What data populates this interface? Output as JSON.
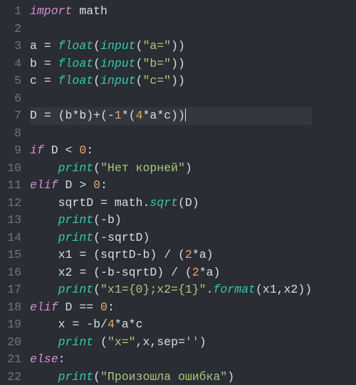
{
  "code_lines": [
    {
      "n": 1,
      "hl": false,
      "tokens": [
        [
          "kw",
          "import"
        ],
        [
          "ws",
          " "
        ],
        [
          "id",
          "math"
        ]
      ]
    },
    {
      "n": 2,
      "hl": false,
      "tokens": []
    },
    {
      "n": 3,
      "hl": false,
      "tokens": [
        [
          "id",
          "a"
        ],
        [
          "ws",
          " "
        ],
        [
          "op",
          "="
        ],
        [
          "ws",
          " "
        ],
        [
          "fn",
          "float"
        ],
        [
          "pn",
          "("
        ],
        [
          "fn",
          "input"
        ],
        [
          "pn",
          "("
        ],
        [
          "str",
          "\"a=\""
        ],
        [
          "pn",
          "))"
        ]
      ]
    },
    {
      "n": 4,
      "hl": false,
      "tokens": [
        [
          "id",
          "b"
        ],
        [
          "ws",
          " "
        ],
        [
          "op",
          "="
        ],
        [
          "ws",
          " "
        ],
        [
          "fn",
          "float"
        ],
        [
          "pn",
          "("
        ],
        [
          "fn",
          "input"
        ],
        [
          "pn",
          "("
        ],
        [
          "str",
          "\"b=\""
        ],
        [
          "pn",
          "))"
        ]
      ]
    },
    {
      "n": 5,
      "hl": false,
      "tokens": [
        [
          "id",
          "c"
        ],
        [
          "ws",
          " "
        ],
        [
          "op",
          "="
        ],
        [
          "ws",
          " "
        ],
        [
          "fn",
          "float"
        ],
        [
          "pn",
          "("
        ],
        [
          "fn",
          "input"
        ],
        [
          "pn",
          "("
        ],
        [
          "str",
          "\"c=\""
        ],
        [
          "pn",
          "))"
        ]
      ]
    },
    {
      "n": 6,
      "hl": false,
      "tokens": []
    },
    {
      "n": 7,
      "hl": true,
      "tokens": [
        [
          "id",
          "D"
        ],
        [
          "ws",
          " "
        ],
        [
          "op",
          "="
        ],
        [
          "ws",
          " "
        ],
        [
          "pn",
          "("
        ],
        [
          "id",
          "b"
        ],
        [
          "op",
          "*"
        ],
        [
          "id",
          "b"
        ],
        [
          "pn",
          ")"
        ],
        [
          "op",
          "+"
        ],
        [
          "pn",
          "("
        ],
        [
          "op",
          "-"
        ],
        [
          "num",
          "1"
        ],
        [
          "op",
          "*"
        ],
        [
          "pn",
          "("
        ],
        [
          "num",
          "4"
        ],
        [
          "op",
          "*"
        ],
        [
          "id",
          "a"
        ],
        [
          "op",
          "*"
        ],
        [
          "id",
          "c"
        ],
        [
          "pn",
          "))"
        ],
        [
          "cursor",
          ""
        ]
      ]
    },
    {
      "n": 8,
      "hl": false,
      "tokens": []
    },
    {
      "n": 9,
      "hl": false,
      "tokens": [
        [
          "kw",
          "if"
        ],
        [
          "ws",
          " "
        ],
        [
          "id",
          "D"
        ],
        [
          "ws",
          " "
        ],
        [
          "op",
          "<"
        ],
        [
          "ws",
          " "
        ],
        [
          "num",
          "0"
        ],
        [
          "pn",
          ":"
        ]
      ]
    },
    {
      "n": 10,
      "hl": false,
      "tokens": [
        [
          "ws",
          "    "
        ],
        [
          "fn",
          "print"
        ],
        [
          "pn",
          "("
        ],
        [
          "str",
          "\"Нет корней\""
        ],
        [
          "pn",
          ")"
        ]
      ]
    },
    {
      "n": 11,
      "hl": false,
      "tokens": [
        [
          "kw",
          "elif"
        ],
        [
          "ws",
          " "
        ],
        [
          "id",
          "D"
        ],
        [
          "ws",
          " "
        ],
        [
          "op",
          ">"
        ],
        [
          "ws",
          " "
        ],
        [
          "num",
          "0"
        ],
        [
          "pn",
          ":"
        ]
      ]
    },
    {
      "n": 12,
      "hl": false,
      "tokens": [
        [
          "ws",
          "    "
        ],
        [
          "id",
          "sqrtD"
        ],
        [
          "ws",
          " "
        ],
        [
          "op",
          "="
        ],
        [
          "ws",
          " "
        ],
        [
          "id",
          "math"
        ],
        [
          "pn",
          "."
        ],
        [
          "fn",
          "sqrt"
        ],
        [
          "pn",
          "("
        ],
        [
          "id",
          "D"
        ],
        [
          "pn",
          ")"
        ]
      ]
    },
    {
      "n": 13,
      "hl": false,
      "tokens": [
        [
          "ws",
          "    "
        ],
        [
          "fn",
          "print"
        ],
        [
          "pn",
          "("
        ],
        [
          "op",
          "-"
        ],
        [
          "id",
          "b"
        ],
        [
          "pn",
          ")"
        ]
      ]
    },
    {
      "n": 14,
      "hl": false,
      "tokens": [
        [
          "ws",
          "    "
        ],
        [
          "fn",
          "print"
        ],
        [
          "pn",
          "("
        ],
        [
          "op",
          "-"
        ],
        [
          "id",
          "sqrtD"
        ],
        [
          "pn",
          ")"
        ]
      ]
    },
    {
      "n": 15,
      "hl": false,
      "tokens": [
        [
          "ws",
          "    "
        ],
        [
          "id",
          "x1"
        ],
        [
          "ws",
          " "
        ],
        [
          "op",
          "="
        ],
        [
          "ws",
          " "
        ],
        [
          "pn",
          "("
        ],
        [
          "id",
          "sqrtD"
        ],
        [
          "op",
          "-"
        ],
        [
          "id",
          "b"
        ],
        [
          "pn",
          ")"
        ],
        [
          "ws",
          " "
        ],
        [
          "op",
          "/"
        ],
        [
          "ws",
          " "
        ],
        [
          "pn",
          "("
        ],
        [
          "num",
          "2"
        ],
        [
          "op",
          "*"
        ],
        [
          "id",
          "a"
        ],
        [
          "pn",
          ")"
        ]
      ]
    },
    {
      "n": 16,
      "hl": false,
      "tokens": [
        [
          "ws",
          "    "
        ],
        [
          "id",
          "x2"
        ],
        [
          "ws",
          " "
        ],
        [
          "op",
          "="
        ],
        [
          "ws",
          " "
        ],
        [
          "pn",
          "("
        ],
        [
          "op",
          "-"
        ],
        [
          "id",
          "b"
        ],
        [
          "op",
          "-"
        ],
        [
          "id",
          "sqrtD"
        ],
        [
          "pn",
          ")"
        ],
        [
          "ws",
          " "
        ],
        [
          "op",
          "/"
        ],
        [
          "ws",
          " "
        ],
        [
          "pn",
          "("
        ],
        [
          "num",
          "2"
        ],
        [
          "op",
          "*"
        ],
        [
          "id",
          "a"
        ],
        [
          "pn",
          ")"
        ]
      ]
    },
    {
      "n": 17,
      "hl": false,
      "tokens": [
        [
          "ws",
          "    "
        ],
        [
          "fn",
          "print"
        ],
        [
          "pn",
          "("
        ],
        [
          "str",
          "\"x1={0};x2={1}\""
        ],
        [
          "pn",
          "."
        ],
        [
          "fn",
          "format"
        ],
        [
          "pn",
          "("
        ],
        [
          "id",
          "x1"
        ],
        [
          "pn",
          ","
        ],
        [
          "id",
          "x2"
        ],
        [
          "pn",
          "))"
        ]
      ]
    },
    {
      "n": 18,
      "hl": false,
      "tokens": [
        [
          "kw",
          "elif"
        ],
        [
          "ws",
          " "
        ],
        [
          "id",
          "D"
        ],
        [
          "ws",
          " "
        ],
        [
          "op",
          "=="
        ],
        [
          "ws",
          " "
        ],
        [
          "num",
          "0"
        ],
        [
          "pn",
          ":"
        ]
      ]
    },
    {
      "n": 19,
      "hl": false,
      "tokens": [
        [
          "ws",
          "    "
        ],
        [
          "id",
          "x"
        ],
        [
          "ws",
          " "
        ],
        [
          "op",
          "="
        ],
        [
          "ws",
          " "
        ],
        [
          "op",
          "-"
        ],
        [
          "id",
          "b"
        ],
        [
          "op",
          "/"
        ],
        [
          "num",
          "4"
        ],
        [
          "op",
          "*"
        ],
        [
          "id",
          "a"
        ],
        [
          "op",
          "*"
        ],
        [
          "id",
          "c"
        ]
      ]
    },
    {
      "n": 20,
      "hl": false,
      "tokens": [
        [
          "ws",
          "    "
        ],
        [
          "fn",
          "print"
        ],
        [
          "ws",
          " "
        ],
        [
          "pn",
          "("
        ],
        [
          "str",
          "\"x=\""
        ],
        [
          "pn",
          ","
        ],
        [
          "id",
          "x"
        ],
        [
          "pn",
          ","
        ],
        [
          "id",
          "sep"
        ],
        [
          "op",
          "="
        ],
        [
          "str",
          "''"
        ],
        [
          "pn",
          ")"
        ]
      ]
    },
    {
      "n": 21,
      "hl": false,
      "tokens": [
        [
          "kw",
          "else"
        ],
        [
          "pn",
          ":"
        ]
      ]
    },
    {
      "n": 22,
      "hl": false,
      "tokens": [
        [
          "ws",
          "    "
        ],
        [
          "fn",
          "print"
        ],
        [
          "pn",
          "("
        ],
        [
          "str",
          "\"Произошла ошибка\""
        ],
        [
          "pn",
          ")"
        ]
      ]
    }
  ]
}
